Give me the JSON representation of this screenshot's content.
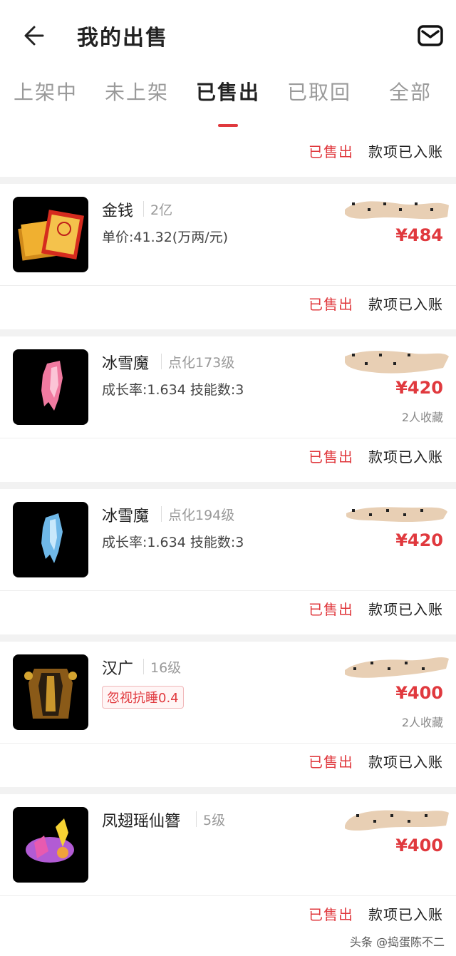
{
  "header": {
    "title": "我的出售",
    "tabs": [
      "上架中",
      "未上架",
      "已售出",
      "已取回",
      "全部"
    ],
    "active_tab": "已售出"
  },
  "status": {
    "sold": "已售出",
    "paid": "款项已入账"
  },
  "items": [
    {
      "name": "金钱",
      "level": "2亿",
      "sub": "单价:41.32(万两/元)",
      "price": "¥484",
      "favorites": ""
    },
    {
      "name": "冰雪魔",
      "level": "点化173级",
      "sub": "成长率:1.634 技能数:3",
      "price": "¥420",
      "favorites": "2人收藏"
    },
    {
      "name": "冰雪魔",
      "level": "点化194级",
      "sub": "成长率:1.634 技能数:3",
      "price": "¥420",
      "favorites": ""
    },
    {
      "name": "汉广",
      "level": "16级",
      "tag": "忽视抗睡0.4",
      "price": "¥400",
      "favorites": "2人收藏"
    },
    {
      "name": "凤翅瑶仙簪",
      "level": "5级",
      "sub": "",
      "price": "¥400",
      "favorites": ""
    }
  ],
  "watermark": "头条 @捣蛋陈不二",
  "colors": {
    "accent": "#e0393e",
    "background": "#f2f2f2"
  }
}
